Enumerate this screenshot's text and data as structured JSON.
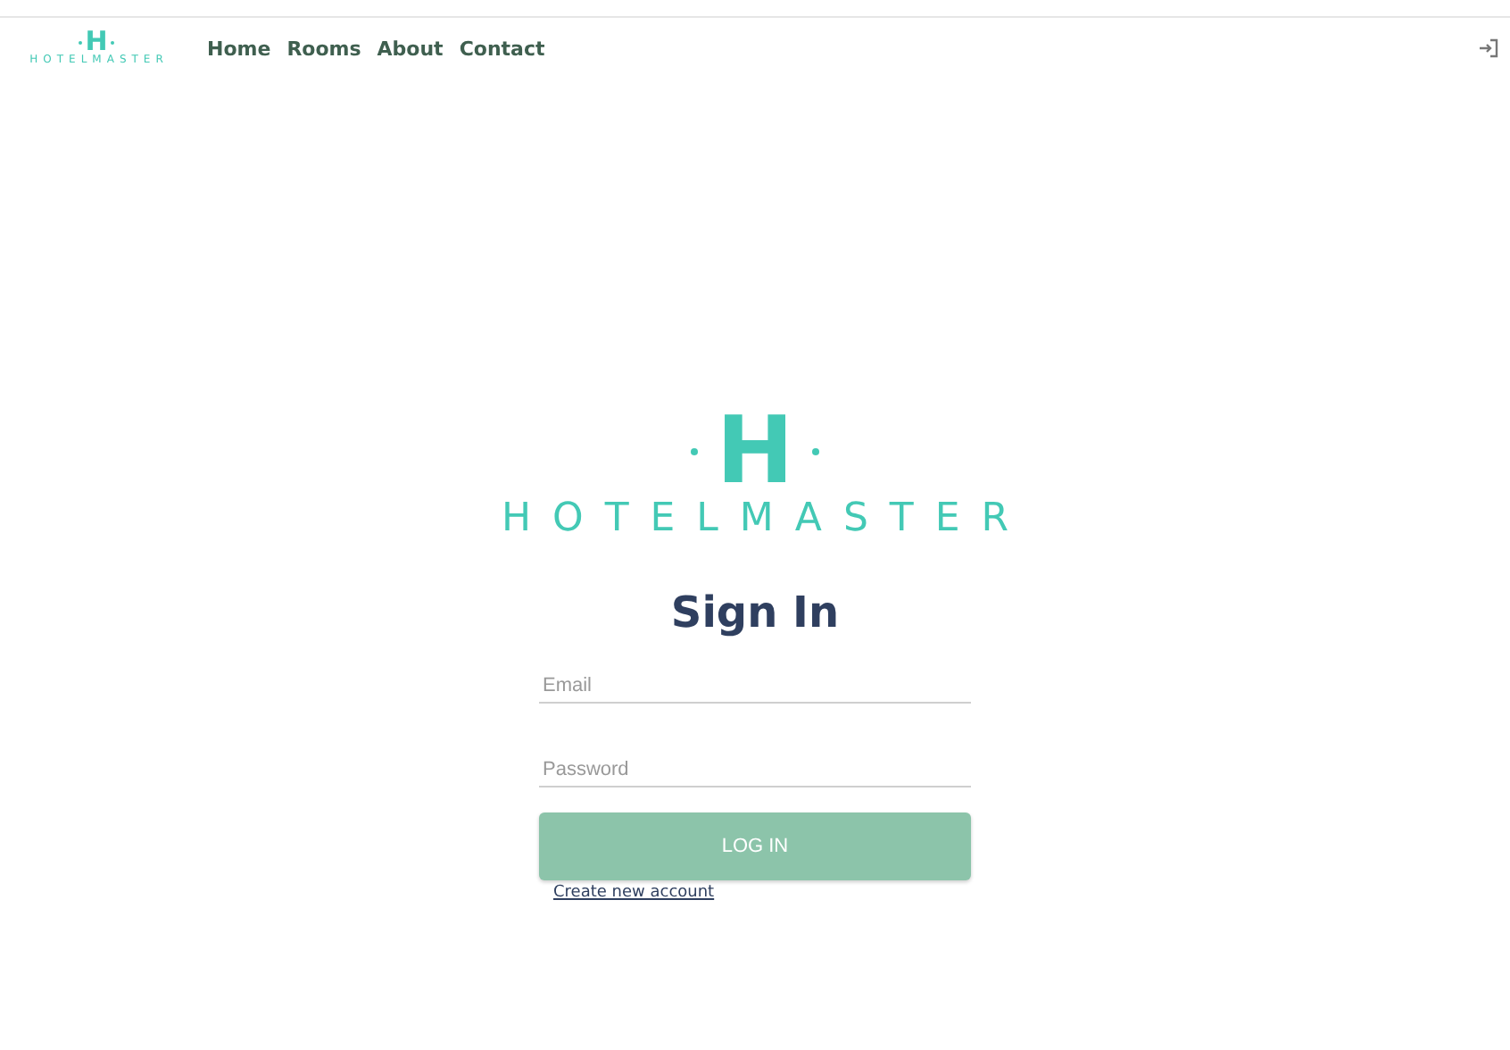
{
  "header": {
    "logo": {
      "letter": "H",
      "wordmark": "HOTELMASTER"
    },
    "nav": [
      {
        "label": "Home"
      },
      {
        "label": "Rooms"
      },
      {
        "label": "About"
      },
      {
        "label": "Contact"
      }
    ]
  },
  "hero_logo": {
    "letter": "H",
    "wordmark": "HOTELMASTER"
  },
  "form": {
    "title": "Sign In",
    "fields": [
      {
        "placeholder": "Email"
      },
      {
        "placeholder": "Password"
      }
    ],
    "button": "LOG IN",
    "link": "Create new account"
  }
}
